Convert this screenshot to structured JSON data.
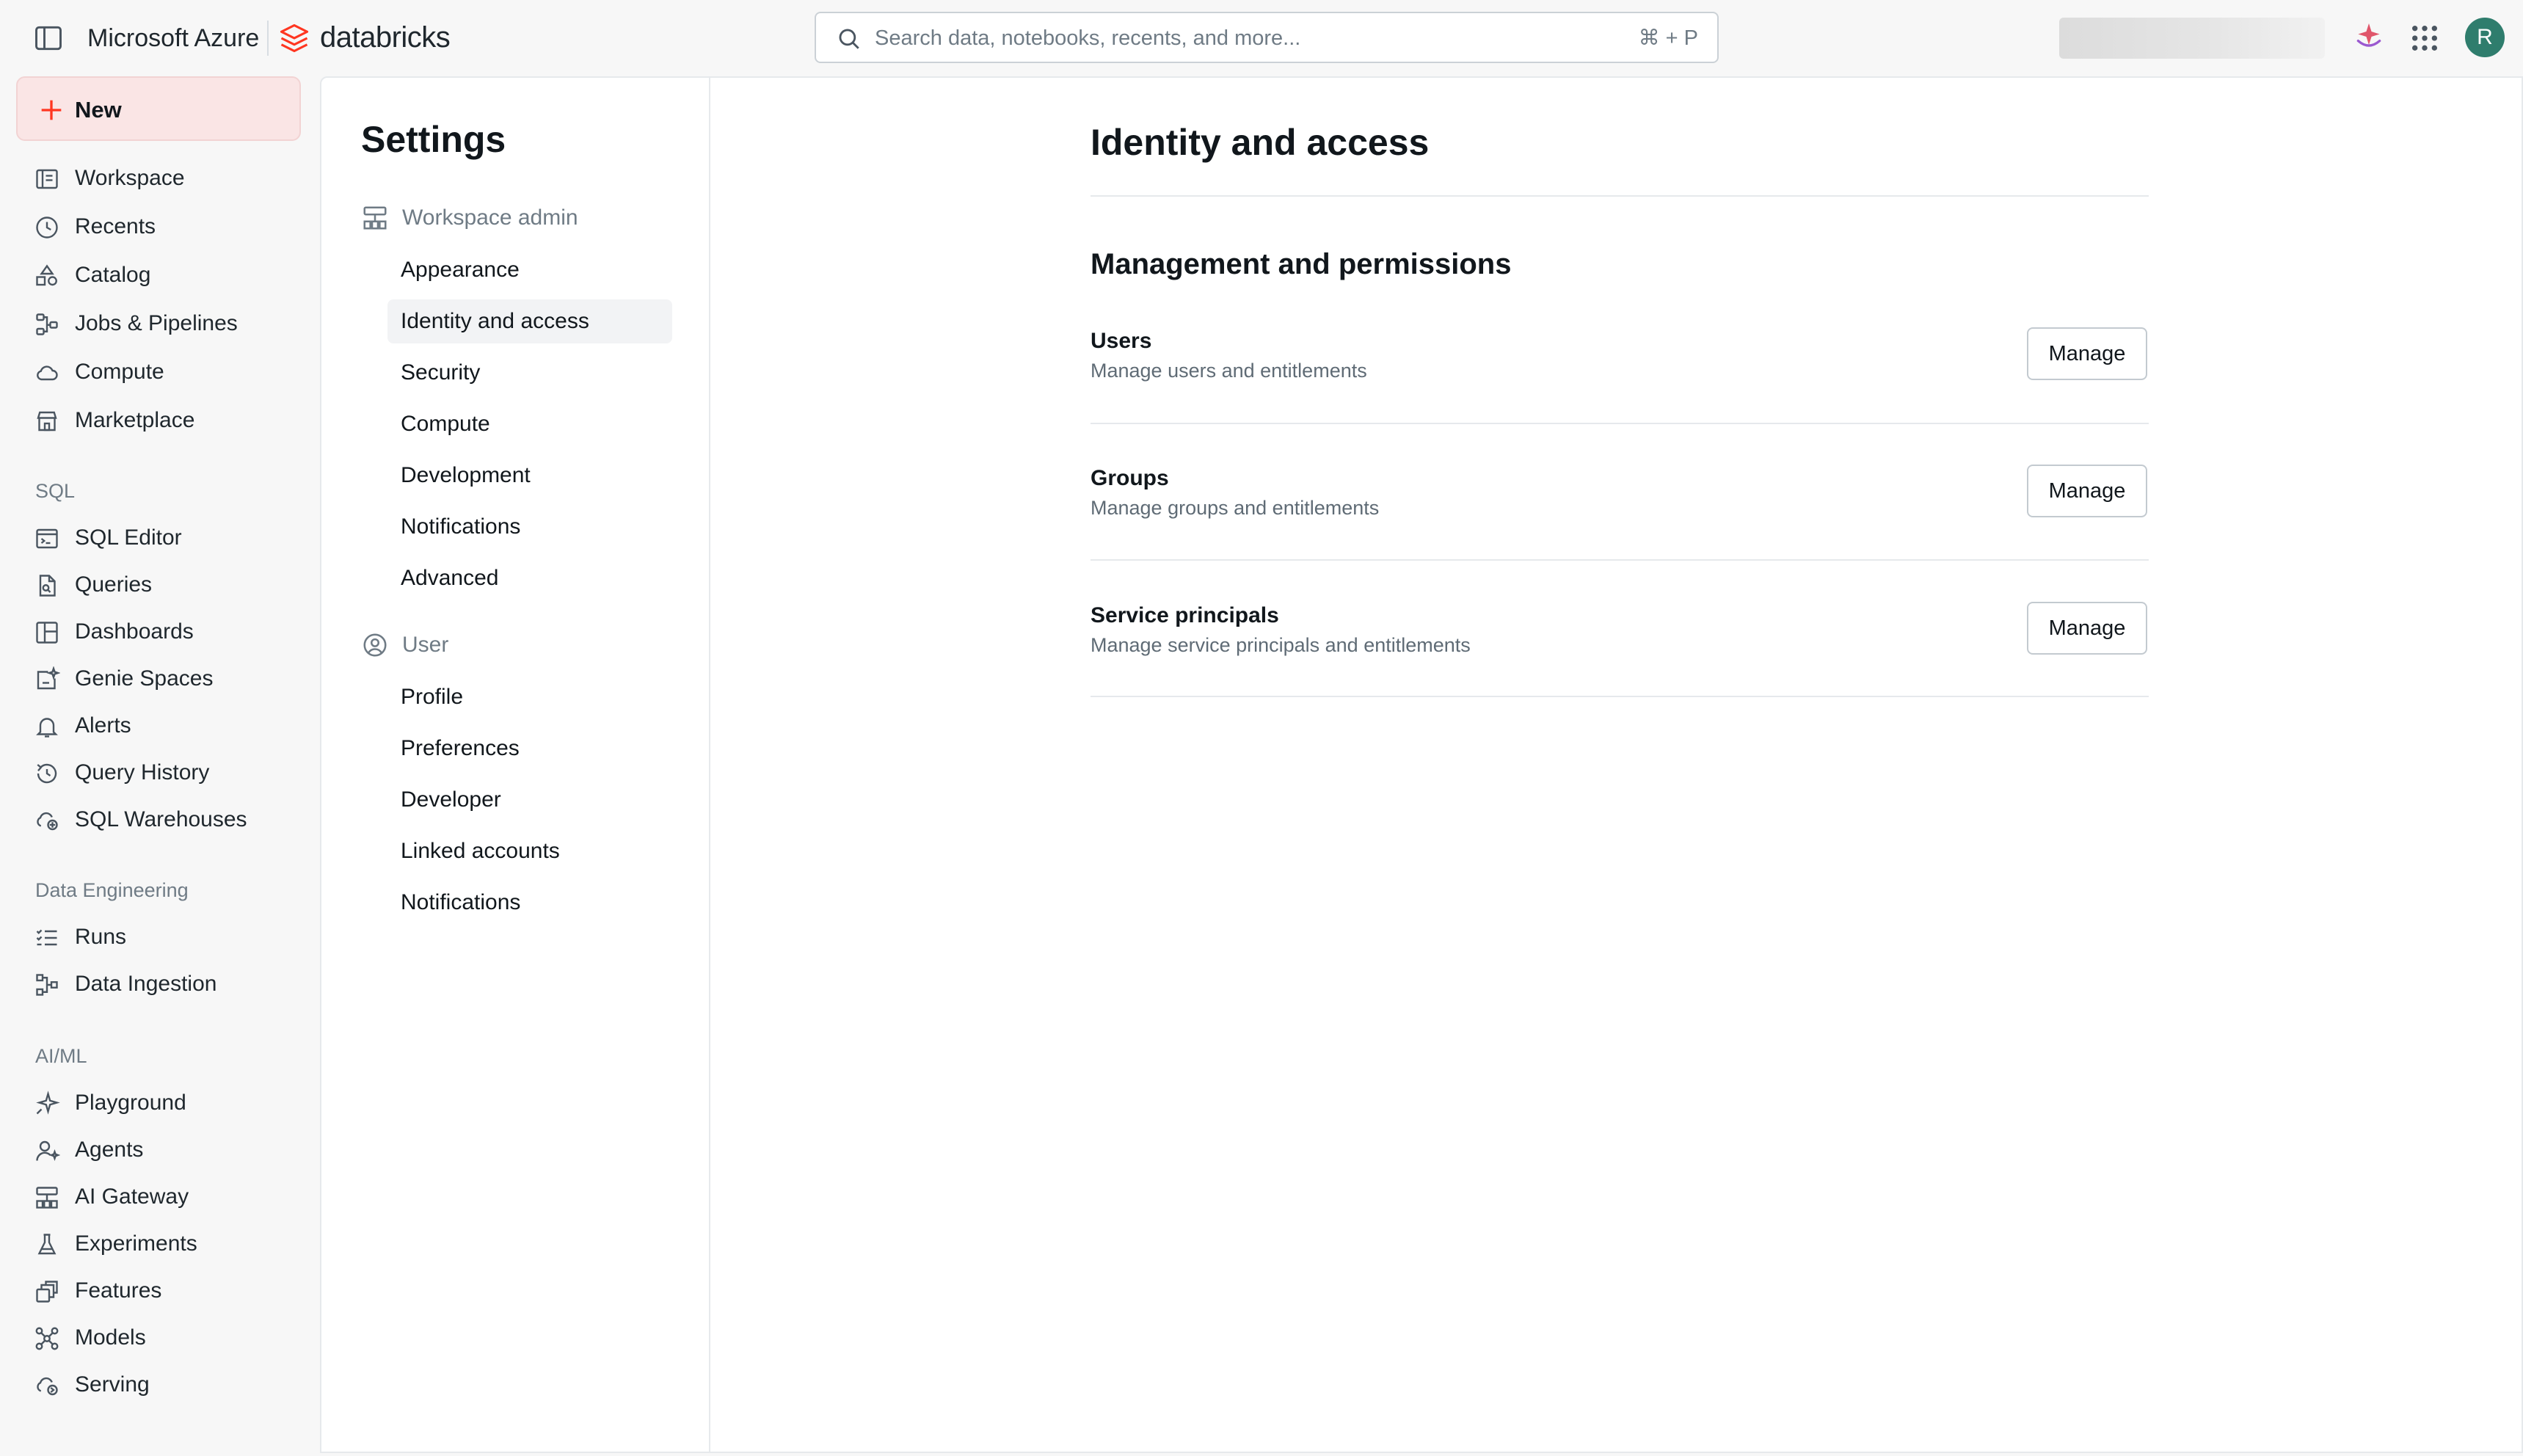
{
  "topbar": {
    "cloud_label": "Microsoft Azure",
    "brand": "databricks",
    "search_placeholder": "Search data, notebooks, recents, and more...",
    "search_shortcut": "⌘ + P",
    "avatar_initial": "R",
    "accent": "#ff3621"
  },
  "nav": {
    "new_label": "New",
    "items": [
      {
        "label": "Workspace",
        "icon": "workspace-icon"
      },
      {
        "label": "Recents",
        "icon": "clock-icon"
      },
      {
        "label": "Catalog",
        "icon": "catalog-icon"
      },
      {
        "label": "Jobs & Pipelines",
        "icon": "workflow-icon"
      },
      {
        "label": "Compute",
        "icon": "cloud-icon"
      },
      {
        "label": "Marketplace",
        "icon": "store-icon"
      }
    ],
    "sql_section": "SQL",
    "sql_items": [
      {
        "label": "SQL Editor",
        "icon": "sql-editor-icon"
      },
      {
        "label": "Queries",
        "icon": "query-file-icon"
      },
      {
        "label": "Dashboards",
        "icon": "dashboard-icon"
      },
      {
        "label": "Genie Spaces",
        "icon": "genie-icon"
      },
      {
        "label": "Alerts",
        "icon": "bell-icon"
      },
      {
        "label": "Query History",
        "icon": "history-icon"
      },
      {
        "label": "SQL Warehouses",
        "icon": "warehouse-icon"
      }
    ],
    "de_section": "Data Engineering",
    "de_items": [
      {
        "label": "Runs",
        "icon": "runs-list-icon"
      },
      {
        "label": "Data Ingestion",
        "icon": "ingestion-icon"
      }
    ],
    "ml_section": "AI/ML",
    "ml_items": [
      {
        "label": "Playground",
        "icon": "sparkle-icon"
      },
      {
        "label": "Agents",
        "icon": "agent-icon"
      },
      {
        "label": "AI Gateway",
        "icon": "gateway-icon"
      },
      {
        "label": "Experiments",
        "icon": "flask-icon"
      },
      {
        "label": "Features",
        "icon": "features-icon"
      },
      {
        "label": "Models",
        "icon": "models-icon"
      },
      {
        "label": "Serving",
        "icon": "serving-icon"
      }
    ]
  },
  "settings": {
    "title": "Settings",
    "workspace_admin_label": "Workspace admin",
    "workspace_admin_items": [
      "Appearance",
      "Identity and access",
      "Security",
      "Compute",
      "Development",
      "Notifications",
      "Advanced"
    ],
    "active_item": "Identity and access",
    "user_label": "User",
    "user_items": [
      "Profile",
      "Preferences",
      "Developer",
      "Linked accounts",
      "Notifications"
    ]
  },
  "content": {
    "title": "Identity and access",
    "section_title": "Management and permissions",
    "rows": [
      {
        "title": "Users",
        "description": "Manage users and entitlements",
        "button": "Manage"
      },
      {
        "title": "Groups",
        "description": "Manage groups and entitlements",
        "button": "Manage"
      },
      {
        "title": "Service principals",
        "description": "Manage service principals and entitlements",
        "button": "Manage"
      }
    ]
  }
}
